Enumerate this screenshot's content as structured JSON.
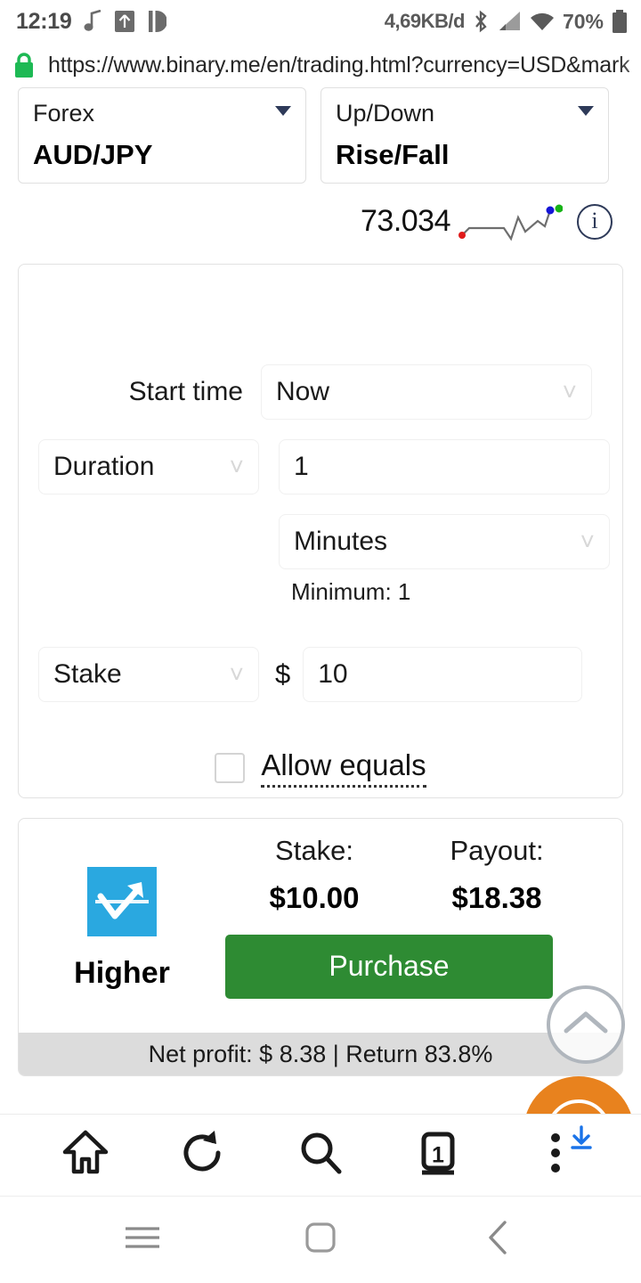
{
  "status_bar": {
    "time": "12:19",
    "data_rate": "4,69KB/d",
    "battery": "70%",
    "icons": [
      "music-note-icon",
      "upload-box-icon",
      "pushbullet-icon",
      "bluetooth-icon",
      "cellular-signal-icon",
      "wifi-icon",
      "battery-icon"
    ]
  },
  "browser": {
    "url": "https://www.binary.me/en/trading.html?currency=USD&mark",
    "lock_icon": "secure-lock-icon",
    "toolbar": {
      "home_label": "home-icon",
      "reload_label": "reload-icon",
      "search_label": "search-icon",
      "tabs_count": "1",
      "menu_label": "more-vertical-icon",
      "download_label": "download-icon"
    }
  },
  "android_nav": {
    "menu": "menu-icon",
    "home": "home-square-icon",
    "back": "back-chevron-icon"
  },
  "trading": {
    "market": {
      "label": "Forex",
      "value": "AUD/JPY"
    },
    "contract": {
      "label": "Up/Down",
      "value": "Rise/Fall"
    },
    "spot": {
      "price": "73.034",
      "info_icon": "info-icon",
      "sparkline_icon": "sparkline-icon"
    },
    "form": {
      "start_time_label": "Start time",
      "start_time_value": "Now",
      "duration_label": "Duration",
      "duration_amount": "1",
      "duration_unit": "Minutes",
      "minimum_hint": "Minimum: 1",
      "stake_label": "Stake",
      "currency_symbol": "$",
      "stake_value": "10",
      "allow_equals_label": "Allow equals",
      "allow_equals_checked": false
    },
    "purchase": {
      "direction": "Higher",
      "direction_icon": "rise-arrow-icon",
      "stake_heading": "Stake:",
      "stake_amount": "$10.00",
      "payout_heading": "Payout:",
      "payout_amount": "$18.38",
      "button_label": "Purchase",
      "net_profit": "Net profit: $ 8.38 | Return 83.8%"
    }
  },
  "floating": {
    "scroll_top_icon": "chevron-up-icon",
    "help_icon": "help-question-icon"
  },
  "colors": {
    "purchase_green": "#2e8b33",
    "help_orange": "#e8821e",
    "direction_blue": "#2aa8e0",
    "lock_green": "#1db954",
    "download_blue": "#1a73e8",
    "netprofit_gray": "#dcdcdc"
  }
}
